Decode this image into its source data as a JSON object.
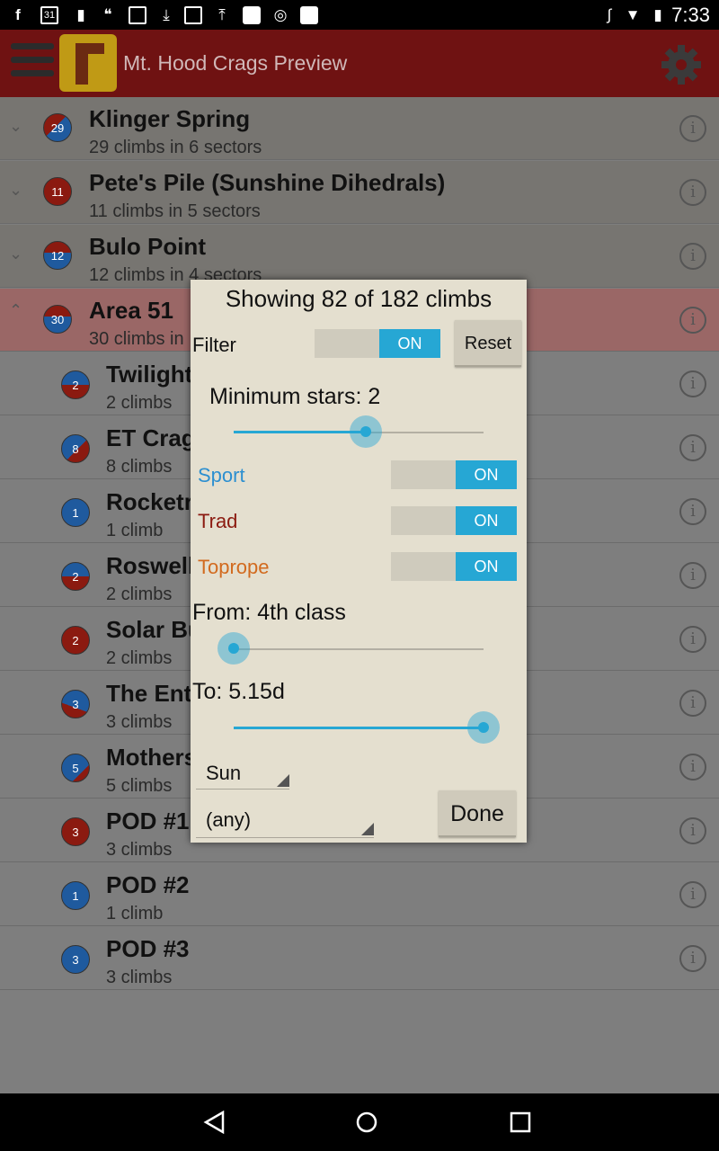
{
  "status_bar": {
    "time": "7:33"
  },
  "app": {
    "title": "Mt. Hood Crags Preview"
  },
  "areas": [
    {
      "name": "Klinger Spring",
      "count": "29",
      "subtitle": "29 climbs in 6 sectors"
    },
    {
      "name": "Pete's Pile (Sunshine Dihedrals)",
      "count": "11",
      "subtitle": "11 climbs in 5 sectors"
    },
    {
      "name": "Bulo Point",
      "count": "12",
      "subtitle": "12 climbs in 4 sectors"
    },
    {
      "name": "Area 51",
      "count": "30",
      "subtitle": "30 climbs in"
    }
  ],
  "sectors": [
    {
      "name": "Twilight",
      "count": "2",
      "subtitle": "2 climbs"
    },
    {
      "name": "ET Crag",
      "count": "8",
      "subtitle": "8 climbs"
    },
    {
      "name": "Rocketr",
      "count": "1",
      "subtitle": "1 climb"
    },
    {
      "name": "Roswell",
      "count": "2",
      "subtitle": "2 climbs"
    },
    {
      "name": "Solar Bu",
      "count": "2",
      "subtitle": "2 climbs"
    },
    {
      "name": "The Ent",
      "count": "3",
      "subtitle": "3 climbs"
    },
    {
      "name": "Mothers",
      "count": "5",
      "subtitle": "5 climbs"
    },
    {
      "name": "POD #1",
      "count": "3",
      "subtitle": "3 climbs"
    },
    {
      "name": "POD #2",
      "count": "1",
      "subtitle": "1 climb"
    },
    {
      "name": "POD #3",
      "count": "3",
      "subtitle": "3 climbs"
    }
  ],
  "dialog": {
    "title": "Showing 82 of 182 climbs",
    "filter_label": "Filter",
    "filter_state": "ON",
    "reset_label": "Reset",
    "min_stars_label": "Minimum stars: 2",
    "min_stars_value": 0.53,
    "sport_label": "Sport",
    "sport_state": "ON",
    "trad_label": "Trad",
    "trad_state": "ON",
    "toprope_label": "Toprope",
    "toprope_state": "ON",
    "from_label": "From: 4th class",
    "from_value": 0.0,
    "to_label": "To: 5.15d",
    "to_value": 1.0,
    "sun_option": "Sun",
    "any_option": "(any)",
    "done_label": "Done"
  },
  "colors": {
    "appbar": "#6f1212",
    "accent": "#26a7d4",
    "sport": "#2c8fd0",
    "trad": "#8b1a10",
    "toprope": "#d26a1e"
  }
}
